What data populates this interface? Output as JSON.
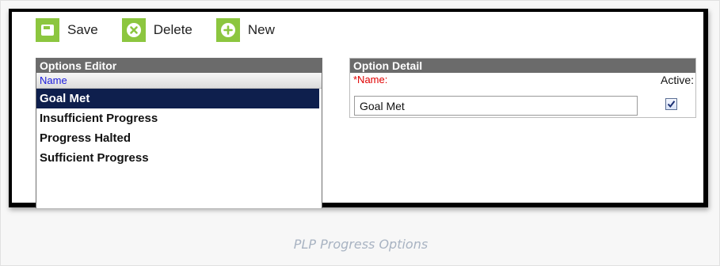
{
  "toolbar": {
    "save_label": "Save",
    "delete_label": "Delete",
    "new_label": "New",
    "icon_color": "#8cc63f"
  },
  "options_editor": {
    "title": "Options Editor",
    "column_header": "Name",
    "items": [
      {
        "label": "Goal Met",
        "selected": true
      },
      {
        "label": "Insufficient Progress",
        "selected": false
      },
      {
        "label": "Progress Halted",
        "selected": false
      },
      {
        "label": "Sufficient Progress",
        "selected": false
      }
    ],
    "selection_color": "#0e1f4d"
  },
  "option_detail": {
    "title": "Option Detail",
    "name_label": "*Name:",
    "name_value": "Goal Met",
    "active_label": "Active:",
    "active_checked": true
  },
  "caption": "PLP Progress Options"
}
